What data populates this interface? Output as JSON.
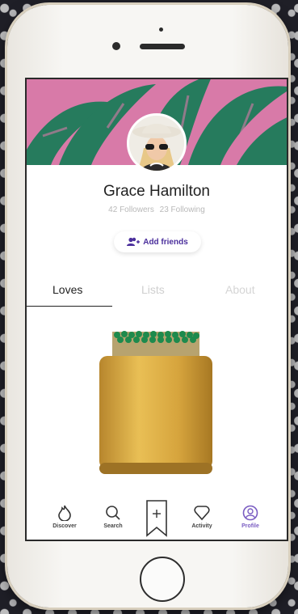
{
  "profile": {
    "name": "Grace Hamilton",
    "followers": "42 Followers",
    "following": "23 Following",
    "add_friends_label": "Add friends"
  },
  "tabs": [
    {
      "label": "Loves",
      "active": true
    },
    {
      "label": "Lists",
      "active": false
    },
    {
      "label": "About",
      "active": false
    }
  ],
  "bottom_nav": [
    {
      "label": "Discover",
      "icon": "flame-icon"
    },
    {
      "label": "Search",
      "icon": "search-icon"
    },
    {
      "label": "",
      "icon": "bookmark-plus-icon"
    },
    {
      "label": "Activity",
      "icon": "heart-icon"
    },
    {
      "label": "Profile",
      "icon": "user-icon",
      "active": true
    }
  ],
  "colors": {
    "accent": "#7a5cc2",
    "cover_pink": "#d87aa8",
    "leaf_green": "#1d7c5a"
  }
}
